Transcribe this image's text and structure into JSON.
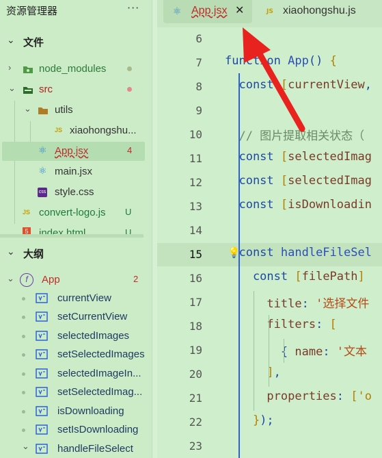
{
  "explorer": {
    "title": "资源管理器",
    "more": "···",
    "files_section": "文件",
    "tree": [
      {
        "name": "node_modules",
        "color": "#2d7a3a",
        "status_color": "#a8b98a"
      },
      {
        "name": "src",
        "color": "#b02020",
        "status_color": "#e08a8a"
      },
      {
        "name": "utils",
        "color": "#333333"
      },
      {
        "name": "xiaohongshu...",
        "color": "#333333",
        "icon_text": "JS"
      },
      {
        "name": "App.jsx",
        "color": "#c02a2a",
        "badge": "4",
        "icon_text": "⚛"
      },
      {
        "name": "main.jsx",
        "color": "#333333",
        "icon_text": "⚛"
      },
      {
        "name": "style.css",
        "color": "#333333",
        "icon_text": "css"
      },
      {
        "name": "convert-logo.js",
        "color": "#1e7a3a",
        "badge": "U",
        "icon_text": "JS"
      },
      {
        "name": "index.html",
        "color": "#1e7a3a",
        "badge": "U",
        "icon_text": "5"
      }
    ],
    "outline_section": "大纲",
    "outline_root": {
      "name": "App",
      "badge": "2",
      "icon_text": "f"
    },
    "outline_items": [
      "currentView",
      "setCurrentView",
      "selectedImages",
      "setSelectedImages",
      "selectedImageIn...",
      "setSelectedImag...",
      "isDownloading",
      "setIsDownloading",
      "handleFileSelect"
    ]
  },
  "tabs": [
    {
      "label": "App.jsx",
      "icon": "react-icon",
      "close": "✕",
      "active": true
    },
    {
      "label": "xiaohongshu.js",
      "icon": "js-icon",
      "active": false
    }
  ],
  "editor": {
    "line_numbers": [
      "6",
      "7",
      "8",
      "9",
      "10",
      "11",
      "12",
      "13",
      "14",
      "15",
      "16",
      "17",
      "18",
      "19",
      "20",
      "21",
      "22",
      "23"
    ],
    "lines": [
      {
        "t": []
      },
      {
        "t": [
          [
            "kw",
            "function "
          ],
          [
            "fn",
            "App"
          ],
          [
            "pn",
            "() "
          ],
          [
            "brk",
            "{"
          ]
        ]
      },
      {
        "t": [
          [
            "kw",
            "  const "
          ],
          [
            "brk",
            "["
          ],
          [
            "var",
            "currentView"
          ],
          [
            "pn",
            ","
          ]
        ]
      },
      {
        "t": []
      },
      {
        "t": [
          [
            "cm",
            "  // 图片提取相关状态（"
          ]
        ]
      },
      {
        "t": [
          [
            "kw",
            "  const "
          ],
          [
            "brk",
            "["
          ],
          [
            "var",
            "selectedImag"
          ]
        ]
      },
      {
        "t": [
          [
            "kw",
            "  const "
          ],
          [
            "brk",
            "["
          ],
          [
            "var",
            "selectedImag"
          ]
        ]
      },
      {
        "t": [
          [
            "kw",
            "  const "
          ],
          [
            "brk",
            "["
          ],
          [
            "var",
            "isDownloadin"
          ]
        ]
      },
      {
        "t": []
      },
      {
        "t": [
          [
            "kw",
            "  const "
          ],
          [
            "fn",
            "handleFileSel"
          ]
        ]
      },
      {
        "t": [
          [
            "kw",
            "    const "
          ],
          [
            "brk",
            "["
          ],
          [
            "var",
            "filePath"
          ],
          [
            "brk",
            "]"
          ]
        ]
      },
      {
        "t": [
          [
            "var",
            "      title"
          ],
          [
            "pn",
            ": "
          ],
          [
            "str",
            "'选择文件"
          ]
        ]
      },
      {
        "t": [
          [
            "var",
            "      filters"
          ],
          [
            "pn",
            ": "
          ],
          [
            "brk",
            "["
          ]
        ]
      },
      {
        "t": [
          [
            "pn",
            "        { "
          ],
          [
            "var",
            "name"
          ],
          [
            "pn",
            ": "
          ],
          [
            "str",
            "'文本"
          ]
        ]
      },
      {
        "t": [
          [
            "brk",
            "      ]"
          ],
          [
            "pn",
            ","
          ]
        ]
      },
      {
        "t": [
          [
            "var",
            "      properties"
          ],
          [
            "pn",
            ": "
          ],
          [
            "brk",
            "['o"
          ]
        ]
      },
      {
        "t": [
          [
            "brk",
            "    }"
          ],
          [
            "pn",
            ");"
          ]
        ]
      },
      {
        "t": []
      }
    ],
    "current_line": "15",
    "bulb": "💡"
  },
  "colors": {
    "accent": "#2b61d8",
    "arrow": "#e8231f",
    "error": "#c02a2a"
  }
}
